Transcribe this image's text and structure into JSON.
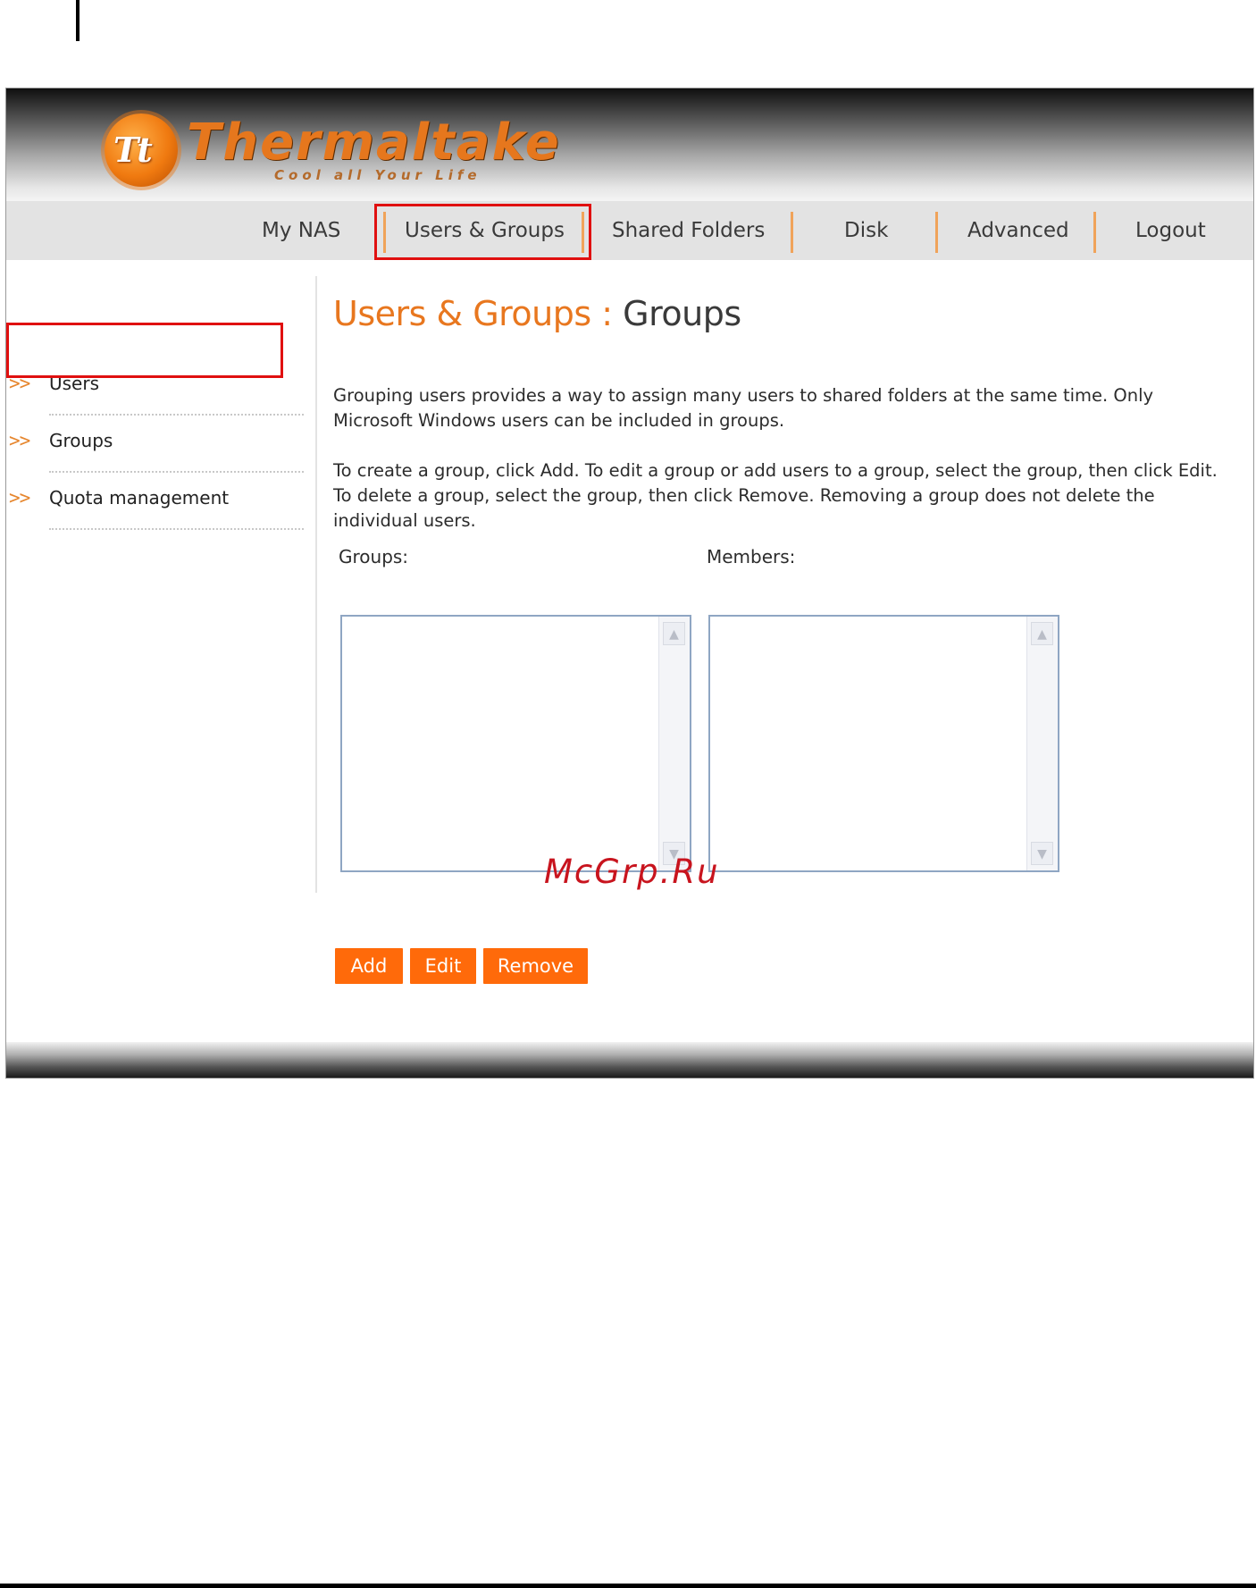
{
  "brand": {
    "name": "Thermaltake",
    "badge": "Tt",
    "tagline": "Cool all Your Life"
  },
  "nav": {
    "items": [
      "My NAS",
      "Users & Groups",
      "Shared Folders",
      "Disk",
      "Advanced",
      "Logout"
    ],
    "active": "Users & Groups"
  },
  "sidebar": {
    "arrow": ">>",
    "items": [
      {
        "label": "Users"
      },
      {
        "label": "Groups"
      },
      {
        "label": "Quota management"
      }
    ],
    "active": "Groups"
  },
  "main": {
    "title_section": "Users & Groups :",
    "title_page": "Groups",
    "para1": "Grouping users provides a way to assign many users to shared folders at the same time. Only Microsoft Windows users can be included in groups.",
    "para2": "To create a group, click Add. To edit a group or add users to a group, select the group, then click Edit. To delete a group, select the group, then click Remove. Removing a group does not delete the individual users.",
    "groups_label": "Groups:",
    "members_label": "Members:",
    "groups": [],
    "members": []
  },
  "buttons": {
    "add": "Add",
    "edit": "Edit",
    "remove": "Remove"
  },
  "colors": {
    "accent": "#ff6a0a",
    "title_orange": "#e8771f",
    "highlight_red": "#e01010",
    "nav_bg": "#e3e3e3"
  },
  "watermark": "McGrp.Ru"
}
